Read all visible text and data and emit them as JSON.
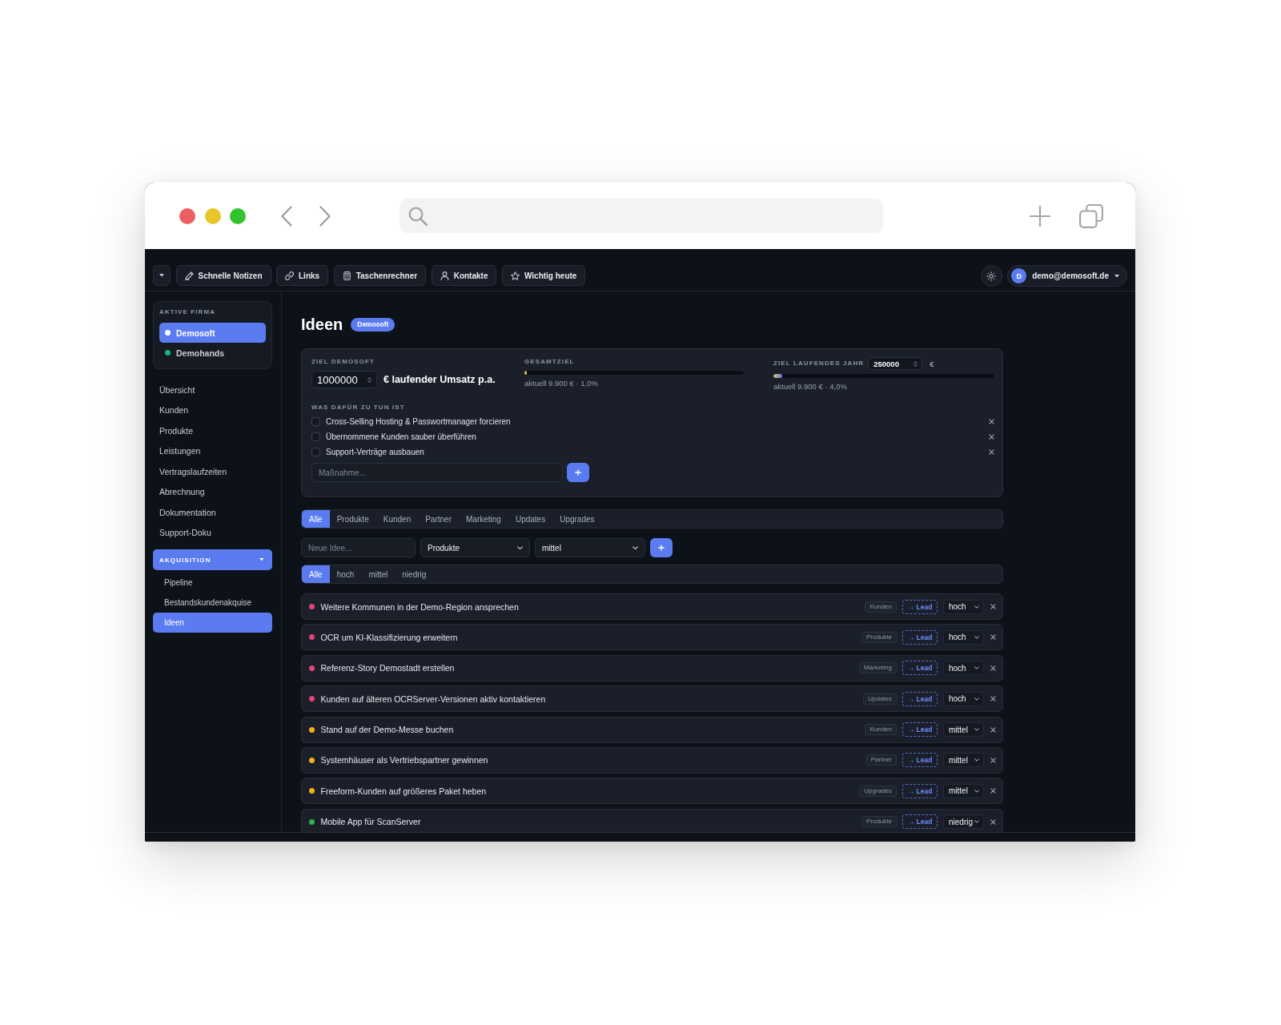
{
  "toolbar": {
    "buttons": [
      "Schnelle Notizen",
      "Links",
      "Taschenrechner",
      "Kontakte",
      "Wichtig heute"
    ],
    "account": {
      "initial": "D",
      "email": "demo@demosoft.de"
    }
  },
  "sidebar": {
    "company_heading": "AKTIVE FIRMA",
    "companies": [
      {
        "name": "Demosoft",
        "selected": true,
        "color": "#ffffff"
      },
      {
        "name": "Demohands",
        "selected": false,
        "color": "#10b981"
      }
    ],
    "nav": [
      {
        "label": "Übersicht",
        "selected": false
      },
      {
        "label": "Kunden",
        "selected": false
      },
      {
        "label": "Produkte",
        "selected": false
      },
      {
        "label": "Leistungen",
        "selected": false
      },
      {
        "label": "Vertragslaufzeiten",
        "selected": false
      },
      {
        "label": "Abrechnung",
        "selected": false
      },
      {
        "label": "Dokumentation",
        "selected": false
      },
      {
        "label": "Support-Doku",
        "selected": false
      }
    ],
    "group": {
      "label": "AKQUISITION",
      "expanded": true,
      "items": [
        {
          "label": "Pipeline",
          "selected": false
        },
        {
          "label": "Bestandskundenakquise",
          "selected": false
        },
        {
          "label": "Ideen",
          "selected": true
        }
      ]
    }
  },
  "page": {
    "title": "Ideen",
    "badge": "Demosoft"
  },
  "goals": {
    "company": {
      "label": "ZIEL DEMOSOFT",
      "value": "1000000",
      "unit": "€ laufender Umsatz p.a."
    },
    "total": {
      "label": "GESAMTZIEL",
      "level": 0.01,
      "reading": "aktuell 9.900 € · 1,0%"
    },
    "year": {
      "label": "ZIEL LAUFENDES JAHR",
      "value": "250000",
      "unit": "€",
      "level": 0.04,
      "reading": "aktuell 9.900 € · 4,0%"
    },
    "todo_heading": "WAS DAFÜR ZU TUN IST",
    "todos": [
      {
        "text": "Cross-Selling Hosting & Passwortmanager forcieren",
        "checked": false
      },
      {
        "text": "Übernommene Kunden sauber überführen",
        "checked": false
      },
      {
        "text": "Support-Verträge ausbauen",
        "checked": false
      }
    ],
    "new_todo": {
      "placeholder": "Maßnahme..."
    }
  },
  "category_tabs": [
    {
      "label": "Alle",
      "selected": true
    },
    {
      "label": "Produkte",
      "selected": false
    },
    {
      "label": "Kunden",
      "selected": false
    },
    {
      "label": "Partner",
      "selected": false
    },
    {
      "label": "Marketing",
      "selected": false
    },
    {
      "label": "Updates",
      "selected": false
    },
    {
      "label": "Upgrades",
      "selected": false
    }
  ],
  "new_idea": {
    "placeholder": "Neue Idee...",
    "category": "Produkte",
    "priority": "mittel"
  },
  "priority_tabs": [
    {
      "label": "Alle",
      "selected": true
    },
    {
      "label": "hoch",
      "selected": false
    },
    {
      "label": "mittel",
      "selected": false
    },
    {
      "label": "niedrig",
      "selected": false
    }
  ],
  "ideas": [
    {
      "title": "Weitere Kommunen in der Demo-Region ansprechen",
      "color": "#e0457a",
      "category": "Kunden",
      "action": "→ Lead",
      "priority": "hoch"
    },
    {
      "title": "OCR um KI-Klassifizierung erweitern",
      "color": "#e0457a",
      "category": "Produkte",
      "action": "→ Lead",
      "priority": "hoch"
    },
    {
      "title": "Referenz-Story Demostadt erstellen",
      "color": "#e0457a",
      "category": "Marketing",
      "action": "→ Lead",
      "priority": "hoch"
    },
    {
      "title": "Kunden auf älteren OCRServer-Versionen aktiv kontaktieren",
      "color": "#e0457a",
      "category": "Updates",
      "action": "→ Lead",
      "priority": "hoch"
    },
    {
      "title": "Stand auf der Demo-Messe buchen",
      "color": "#f2b01e",
      "category": "Kunden",
      "action": "→ Lead",
      "priority": "mittel"
    },
    {
      "title": "Systemhäuser als Vertriebspartner gewinnen",
      "color": "#f2b01e",
      "category": "Partner",
      "action": "→ Lead",
      "priority": "mittel"
    },
    {
      "title": "Freeform-Kunden auf größeres Paket heben",
      "color": "#f2b01e",
      "category": "Upgrades",
      "action": "→ Lead",
      "priority": "mittel"
    },
    {
      "title": "Mobile App für ScanServer",
      "color": "#2fb344",
      "category": "Produkte",
      "action": "→ Lead",
      "priority": "niedrig"
    }
  ]
}
